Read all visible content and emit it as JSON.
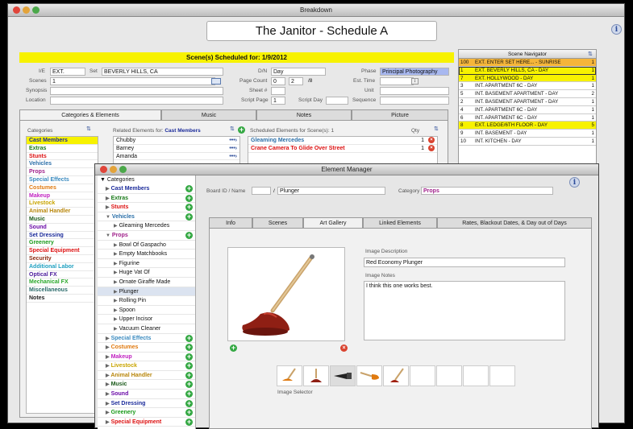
{
  "main_window": {
    "title": "Breakdown",
    "record_title": "The Janitor - Schedule A"
  },
  "header": {
    "scheduled": "Scene(s) Scheduled for: 1/9/2012"
  },
  "fields": {
    "ie_label": "I/E",
    "ie_value": "EXT.",
    "set_label": "Set",
    "set_value": "BEVERLY HILLS, CA",
    "scenes_label": "Scenes",
    "scenes_value": "1",
    "synopsis_label": "Synopsis",
    "location_label": "Location",
    "dn_label": "D/N",
    "dn_value": "Day",
    "page_count_label": "Page Count",
    "page_count_whole": "0",
    "page_count_num": "2",
    "page_count_den": "/8",
    "sheet_label": "Sheet #",
    "script_page_label": "Script Page",
    "script_page_value": "1",
    "script_day_label": "Script Day",
    "phase_label": "Phase",
    "phase_value": "Principal Photography",
    "est_time_label": "Est. Time",
    "unit_label": "Unit",
    "sequence_label": "Sequence"
  },
  "tabs": [
    "Categories & Elements",
    "Music",
    "Notes",
    "Picture"
  ],
  "categories": {
    "header": "Categories",
    "items": [
      {
        "label": "Cast Members",
        "color": "#1a2a9a"
      },
      {
        "label": "Extras",
        "color": "#1a7a1a"
      },
      {
        "label": "Stunts",
        "color": "#d11"
      },
      {
        "label": "Vehicles",
        "color": "#2a6fa8"
      },
      {
        "label": "Props",
        "color": "#a0208a"
      },
      {
        "label": "Special Effects",
        "color": "#3a8abf"
      },
      {
        "label": "Costumes",
        "color": "#e07a10"
      },
      {
        "label": "Makeup",
        "color": "#c020c0"
      },
      {
        "label": "Livestock",
        "color": "#c8a400"
      },
      {
        "label": "Animal Handler",
        "color": "#b8860b"
      },
      {
        "label": "Music",
        "color": "#1a5a1a"
      },
      {
        "label": "Sound",
        "color": "#6a0aa8"
      },
      {
        "label": "Set Dressing",
        "color": "#1a2a9a"
      },
      {
        "label": "Greenery",
        "color": "#1a9a1a"
      },
      {
        "label": "Special Equipment",
        "color": "#d11"
      },
      {
        "label": "Security",
        "color": "#8b2a10"
      },
      {
        "label": "Additional Labor",
        "color": "#20a0c0"
      },
      {
        "label": "Optical FX",
        "color": "#4a1a9a"
      },
      {
        "label": "Mechanical FX",
        "color": "#2aa82a"
      },
      {
        "label": "Miscellaneous",
        "color": "#2a6a6a"
      },
      {
        "label": "Notes",
        "color": "#222"
      }
    ]
  },
  "related": {
    "header": "Related Elements for:",
    "category": "Cast Members",
    "items": [
      "Chubby",
      "Barney",
      "Amanda"
    ]
  },
  "scheduled_elements": {
    "header": "Scheduled Elements for Scene(s): 1",
    "qty_label": "Qty",
    "items": [
      {
        "label": "Gleaming Mercedes",
        "qty": "1",
        "color": "#2a6fa8"
      },
      {
        "label": "Crane Camera To Glide Over Street",
        "qty": "1",
        "color": "#d11"
      }
    ]
  },
  "scene_navigator": {
    "title": "Scene Navigator",
    "rows": [
      {
        "n": "100",
        "t": "EXT. ENTER SET HERE... - SUNRISE",
        "p": "1",
        "hl": "orange"
      },
      {
        "n": "1",
        "t": "EXT. BEVERLY HILLS, CA - DAY",
        "p": "1",
        "hl": "yellow-sel"
      },
      {
        "n": "7",
        "t": "EXT. HOLLYWOOD - DAY",
        "p": "1",
        "hl": "yellow"
      },
      {
        "n": "3",
        "t": "INT. APARTMENT 6C - DAY",
        "p": "1",
        "hl": ""
      },
      {
        "n": "5",
        "t": "INT. BASEMENT APARTMENT - DAY",
        "p": "2",
        "hl": ""
      },
      {
        "n": "2",
        "t": "INT. BASEMENT APARTMENT - DAY",
        "p": "1",
        "hl": ""
      },
      {
        "n": "4",
        "t": "INT. APARTMENT 6C - DAY",
        "p": "1",
        "hl": ""
      },
      {
        "n": "6",
        "t": "INT. APARTMENT 6C - DAY",
        "p": "1",
        "hl": ""
      },
      {
        "n": "8",
        "t": "EXT. LEDGE/6TH FLOOR - DAY",
        "p": "5",
        "hl": "yellow"
      },
      {
        "n": "9",
        "t": "INT. BASEMENT - DAY",
        "p": "1",
        "hl": ""
      },
      {
        "n": "10",
        "t": "INT. KITCHEN - DAY",
        "p": "1",
        "hl": ""
      }
    ]
  },
  "element_manager": {
    "title": "Element Manager",
    "board_label": "Board ID / Name",
    "board_sep": "/",
    "name_value": "Plunger",
    "category_label": "Category",
    "category_value": "Props",
    "tabs": [
      "Info",
      "Scenes",
      "Art Gallery",
      "Linked Elements",
      "Rates, Blackout Dates, & Day out of Days"
    ],
    "image_description_label": "Image Description",
    "image_description": "Red Economy Plunger",
    "image_notes_label": "Image Notes",
    "image_notes": "I think this one works best.",
    "image_selector_label": "Image Selector",
    "tree_root": "Categories",
    "tree": [
      {
        "label": "Cast Members",
        "color": "#1a2a9a",
        "level": 1,
        "arrow": "▶",
        "plus": true
      },
      {
        "label": "Extras",
        "color": "#1a7a1a",
        "level": 1,
        "arrow": "▶",
        "plus": true
      },
      {
        "label": "Stunts",
        "color": "#d11",
        "level": 1,
        "arrow": "▶",
        "plus": true
      },
      {
        "label": "Vehicles",
        "color": "#2a6fa8",
        "level": 1,
        "arrow": "▼",
        "plus": true
      },
      {
        "label": "Gleaming Mercedes",
        "color": "#111",
        "level": 2,
        "arrow": "▶",
        "plus": false
      },
      {
        "label": "Props",
        "color": "#a0208a",
        "level": 1,
        "arrow": "▼",
        "plus": true
      },
      {
        "label": "Bowl Of Gaspacho",
        "color": "#111",
        "level": 2,
        "arrow": "▶",
        "plus": false
      },
      {
        "label": "Empty Matchbooks",
        "color": "#111",
        "level": 2,
        "arrow": "▶",
        "plus": false
      },
      {
        "label": "Figurine",
        "color": "#111",
        "level": 2,
        "arrow": "▶",
        "plus": false
      },
      {
        "label": "Huge Vat Of",
        "color": "#111",
        "level": 2,
        "arrow": "▶",
        "plus": false
      },
      {
        "label": "Ornate Giraffe Made",
        "color": "#111",
        "level": 2,
        "arrow": "▶",
        "plus": false
      },
      {
        "label": "Plunger",
        "color": "#111",
        "level": 2,
        "arrow": "▶",
        "plus": false,
        "selected": true
      },
      {
        "label": "Rolling Pin",
        "color": "#111",
        "level": 2,
        "arrow": "▶",
        "plus": false
      },
      {
        "label": "Spoon",
        "color": "#111",
        "level": 2,
        "arrow": "▶",
        "plus": false
      },
      {
        "label": "Upper Incisor",
        "color": "#111",
        "level": 2,
        "arrow": "▶",
        "plus": false
      },
      {
        "label": "Vacuum Cleaner",
        "color": "#111",
        "level": 2,
        "arrow": "▶",
        "plus": false
      },
      {
        "label": "Special Effects",
        "color": "#3a8abf",
        "level": 1,
        "arrow": "▶",
        "plus": true
      },
      {
        "label": "Costumes",
        "color": "#e07a10",
        "level": 1,
        "arrow": "▶",
        "plus": true
      },
      {
        "label": "Makeup",
        "color": "#c020c0",
        "level": 1,
        "arrow": "▶",
        "plus": true
      },
      {
        "label": "Livestock",
        "color": "#c8a400",
        "level": 1,
        "arrow": "▶",
        "plus": true
      },
      {
        "label": "Animal Handler",
        "color": "#b8860b",
        "level": 1,
        "arrow": "▶",
        "plus": true
      },
      {
        "label": "Music",
        "color": "#1a5a1a",
        "level": 1,
        "arrow": "▶",
        "plus": true
      },
      {
        "label": "Sound",
        "color": "#6a0aa8",
        "level": 1,
        "arrow": "▶",
        "plus": true
      },
      {
        "label": "Set Dressing",
        "color": "#1a2a9a",
        "level": 1,
        "arrow": "▶",
        "plus": true
      },
      {
        "label": "Greenery",
        "color": "#1a9a1a",
        "level": 1,
        "arrow": "▶",
        "plus": true
      },
      {
        "label": "Special Equipment",
        "color": "#d11",
        "level": 1,
        "arrow": "▶",
        "plus": true
      }
    ]
  },
  "colors": {
    "yellow": "#f7f200",
    "orange": "#f5b53a",
    "accent_blue": "#2c4c99"
  },
  "icons": {
    "info": "info-icon",
    "add": "plus-circle-icon",
    "remove": "x-circle-icon",
    "sort": "sort-icon",
    "link": "arrow-link-icon"
  }
}
